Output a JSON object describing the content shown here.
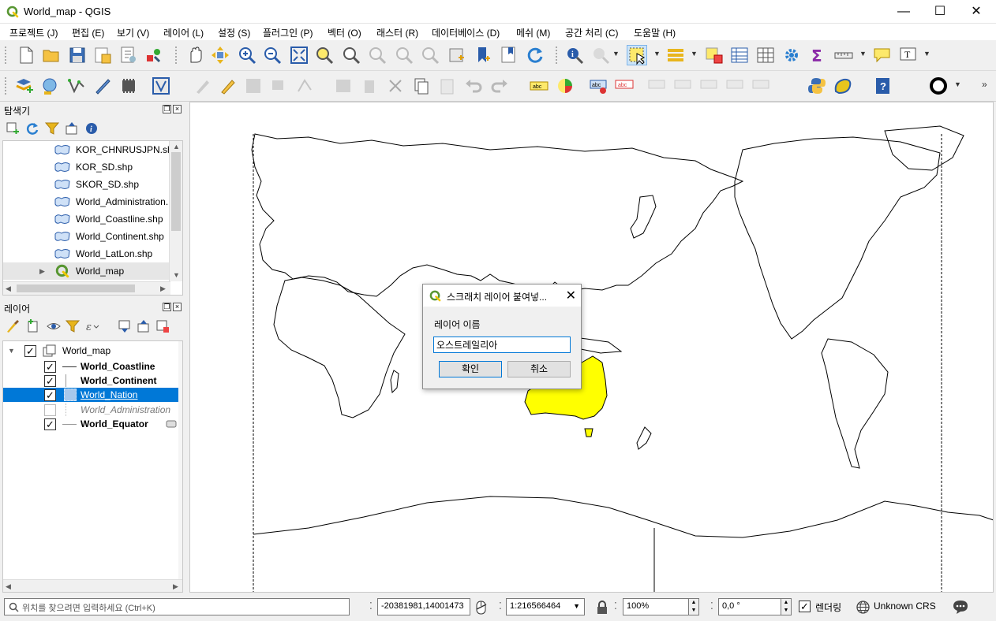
{
  "window": {
    "title": "World_map - QGIS",
    "minimize": "—",
    "maximize": "☐",
    "close": "✕"
  },
  "menu": [
    {
      "label": "프로젝트 (J)"
    },
    {
      "label": "편집 (E)"
    },
    {
      "label": "보기 (V)"
    },
    {
      "label": "레이어 (L)"
    },
    {
      "label": "설정 (S)"
    },
    {
      "label": "플러그인 (P)"
    },
    {
      "label": "벡터 (O)"
    },
    {
      "label": "래스터 (R)"
    },
    {
      "label": "데이터베이스 (D)"
    },
    {
      "label": "메쉬 (M)"
    },
    {
      "label": "공간 처리 (C)"
    },
    {
      "label": "도움말 (H)"
    }
  ],
  "browser": {
    "title": "탐색기",
    "items": [
      {
        "label": "KOR_CHNRUSJPN.shp",
        "icon": "polygon-layer-icon"
      },
      {
        "label": "KOR_SD.shp",
        "icon": "polygon-layer-icon"
      },
      {
        "label": "SKOR_SD.shp",
        "icon": "polygon-layer-icon"
      },
      {
        "label": "World_Administration.",
        "icon": "polygon-layer-icon"
      },
      {
        "label": "World_Coastline.shp",
        "icon": "polygon-layer-icon"
      },
      {
        "label": "World_Continent.shp",
        "icon": "polygon-layer-icon"
      },
      {
        "label": "World_LatLon.shp",
        "icon": "polygon-layer-icon"
      },
      {
        "label": "World_map",
        "icon": "qgis-project-icon"
      }
    ]
  },
  "layers": {
    "title": "레이어",
    "group": {
      "label": "World_map",
      "checked": true
    },
    "items": [
      {
        "label": "World_Coastline",
        "checked": true,
        "selected": false,
        "disabled": false
      },
      {
        "label": "World_Continent",
        "checked": true,
        "selected": false,
        "disabled": false
      },
      {
        "label": "World_Nation",
        "checked": true,
        "selected": true,
        "disabled": false
      },
      {
        "label": "World_Administration",
        "checked": false,
        "selected": false,
        "disabled": true
      },
      {
        "label": "World_Equator",
        "checked": true,
        "selected": false,
        "disabled": false
      }
    ]
  },
  "dialog": {
    "title": "스크래치 레이어 붙여넣...",
    "close": "✕",
    "label": "레이어 이름",
    "value": "오스트레일리아",
    "ok": "확인",
    "cancel": "취소"
  },
  "status": {
    "search_placeholder": "위치를 찾으려면 입력하세요 (Ctrl+K)",
    "coordinate": "-20381981,14001473",
    "scale": "1:216566464",
    "magnifier": "100%",
    "rotation": "0,0 °",
    "render_label": "렌더링",
    "render_checked": true,
    "crs": "Unknown CRS"
  },
  "colors": {
    "selection": "#0078d7",
    "highlight_country": "#ffff00",
    "qgis_green": "#589632"
  }
}
